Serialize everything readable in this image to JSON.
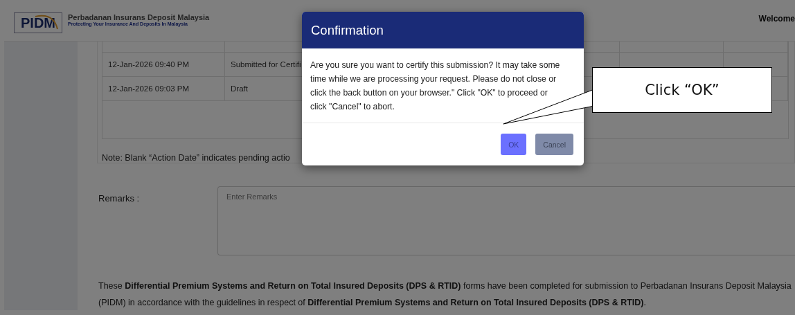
{
  "header": {
    "logo": "PIDM",
    "org_name": "Perbadanan Insurans Deposit Malaysia",
    "tagline": "Protecting Your Insurance And Deposits In Malaysia",
    "welcome": "Welcome"
  },
  "history_table": {
    "rows": [
      {
        "cells": [
          "12-Jan-2026 09:40 PM",
          "Submitted for Certifi"
        ]
      },
      {
        "cells": [
          "12-Jan-2026 09:03 PM",
          "Draft"
        ]
      }
    ]
  },
  "note": "Note: Blank “Action Date” indicates pending actio",
  "remarks": {
    "label": "Remarks :",
    "placeholder": "Enter Remarks"
  },
  "declaration": "These **Differential Premium Systems and Return on Total Insured Deposits (DPS & RTID)** forms have been completed for submission to Perbadanan Insurans Deposit Malaysia (PIDM) in accordance with the guidelines in respect of **Differential Premium Systems and Return on Total Insured Deposits (DPS & RTID)**.",
  "dialog": {
    "title": "Confirmation",
    "message": "Are you sure you want to certify this submission? It may take some time while we are processing your request. Please do not close or click the back button on your browser.\" Click \"OK\" to proceed or click \"Cancel\" to abort.",
    "buttons": [
      {
        "label": "OK",
        "kind": "primary"
      },
      {
        "label": "Cancel",
        "kind": "secondary"
      }
    ]
  },
  "callout": {
    "text": "Click “OK”"
  }
}
